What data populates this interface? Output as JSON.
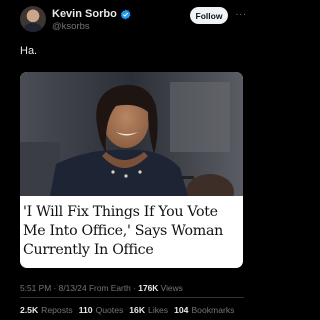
{
  "author": {
    "name": "Kevin Sorbo",
    "handle": "@ksorbs",
    "verified": true
  },
  "actions": {
    "follow_label": "Follow",
    "more_label": "···"
  },
  "tweet": {
    "text": "Ha."
  },
  "media": {
    "headline": "'I Will Fix Things If You Vote Me Into Office,' Says Woman Currently In Office"
  },
  "meta": {
    "time": "5:51 PM",
    "separator": "·",
    "date": "8/13/24",
    "source": "From Earth",
    "views_count": "176K",
    "views_label": "Views"
  },
  "stats": [
    {
      "count": "2.5K",
      "label": "Reposts"
    },
    {
      "count": "110",
      "label": "Quotes"
    },
    {
      "count": "16K",
      "label": "Likes"
    },
    {
      "count": "104",
      "label": "Bookmarks"
    }
  ],
  "colors": {
    "background": "#000000",
    "text": "#e7e9ea",
    "muted": "#71767b",
    "verified": "#1d9bf0"
  }
}
